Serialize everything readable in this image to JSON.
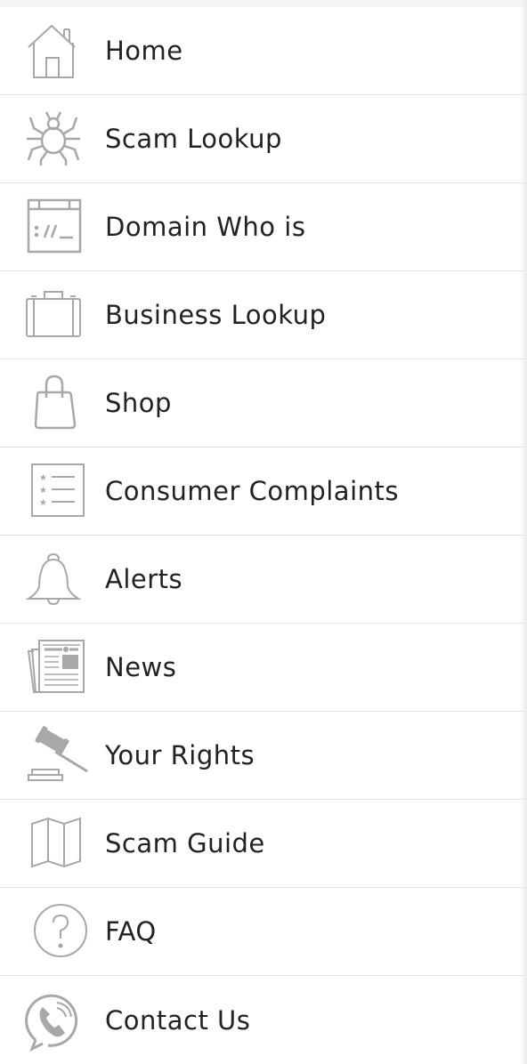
{
  "theme": {
    "text_color": "#222222",
    "icon_color": "#a8a8a8",
    "divider_color": "#e3e3e3"
  },
  "menu": {
    "items": [
      {
        "label": "Home",
        "icon": "home-icon"
      },
      {
        "label": "Scam Lookup",
        "icon": "spider-icon"
      },
      {
        "label": "Domain Who is",
        "icon": "browser-window-icon"
      },
      {
        "label": "Business Lookup",
        "icon": "briefcase-icon"
      },
      {
        "label": "Shop",
        "icon": "shopping-bag-icon"
      },
      {
        "label": "Consumer Complaints",
        "icon": "starred-list-icon"
      },
      {
        "label": "Alerts",
        "icon": "bell-icon"
      },
      {
        "label": "News",
        "icon": "newspaper-icon"
      },
      {
        "label": "Your Rights",
        "icon": "gavel-icon"
      },
      {
        "label": "Scam Guide",
        "icon": "map-icon"
      },
      {
        "label": "FAQ",
        "icon": "question-circle-icon"
      },
      {
        "label": "Contact Us",
        "icon": "phone-circle-icon"
      }
    ]
  }
}
